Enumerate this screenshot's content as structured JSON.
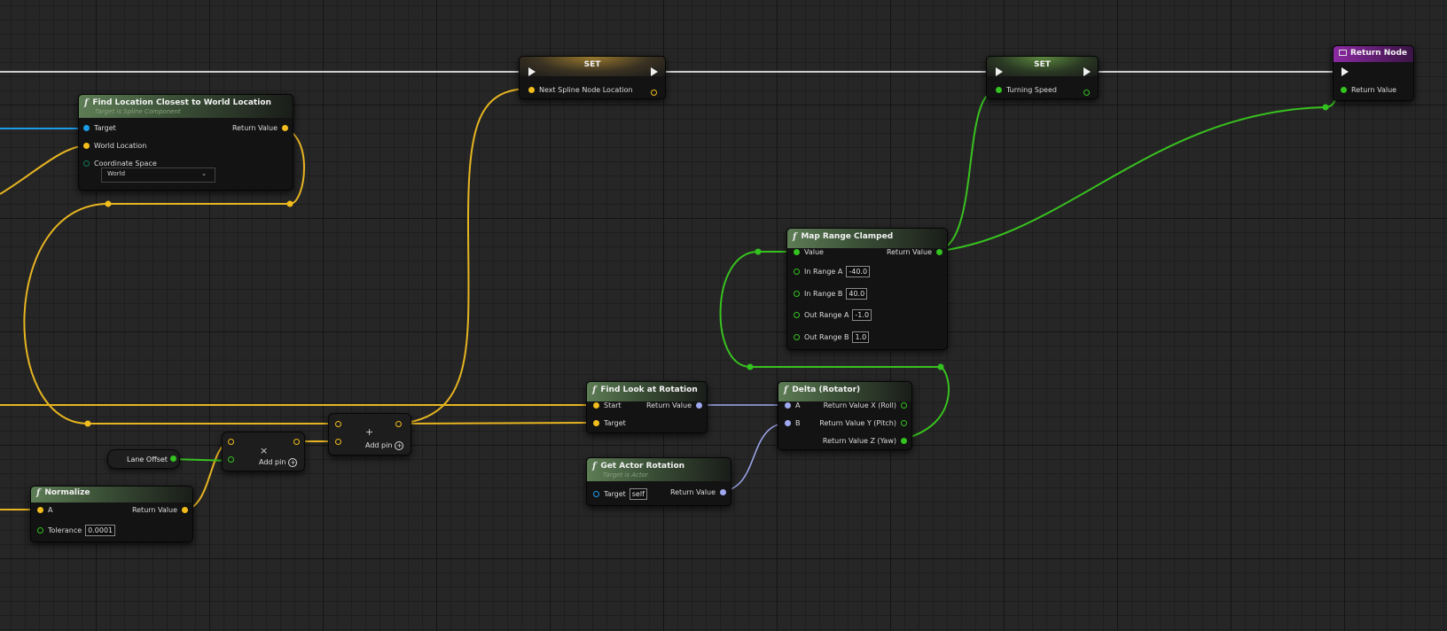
{
  "colors": {
    "exec_wire": "#d9d9d9",
    "vector_pin": "#f2bd1c",
    "float_pin": "#33c21f",
    "object_pin": "#1b9ce6",
    "rotator_pin": "#9fa8ef",
    "return_header": "#8c2aa3"
  },
  "find_location": {
    "title": "Find Location Closest to World Location",
    "subtitle": "Target is Spline Component",
    "target": "Target",
    "world_location": "World Location",
    "return_value": "Return Value",
    "coordinate_space": "Coordinate Space",
    "coordinate_space_value": "World"
  },
  "set_location": {
    "title": "SET",
    "var": "Next Spline Node Location"
  },
  "set_speed": {
    "title": "SET",
    "var": "Turning Speed"
  },
  "return_node": {
    "title": "Return Node",
    "return_value": "Return Value"
  },
  "map_range": {
    "title": "Map Range Clamped",
    "value": "Value",
    "return_value": "Return Value",
    "in_range_a": "In Range A",
    "in_range_a_val": "-40.0",
    "in_range_b": "In Range B",
    "in_range_b_val": "40.0",
    "out_range_a": "Out Range A",
    "out_range_a_val": "-1.0",
    "out_range_b": "Out Range B",
    "out_range_b_val": "1.0"
  },
  "find_look": {
    "title": "Find Look at Rotation",
    "start": "Start",
    "target": "Target",
    "return_value": "Return Value"
  },
  "delta": {
    "title": "Delta (Rotator)",
    "a": "A",
    "b": "B",
    "roll": "Return Value X (Roll)",
    "pitch": "Return Value Y (Pitch)",
    "yaw": "Return Value Z (Yaw)"
  },
  "get_actor_rotation": {
    "title": "Get Actor Rotation",
    "subtitle": "Target is Actor",
    "target": "Target",
    "target_val": "self",
    "return_value": "Return Value"
  },
  "normalize": {
    "title": "Normalize",
    "a": "A",
    "return_value": "Return Value",
    "tolerance": "Tolerance",
    "tolerance_val": "0.0001"
  },
  "lane_offset": {
    "label": "Lane Offset"
  },
  "multiply": {
    "op": "×",
    "add_pin": "Add pin"
  },
  "add": {
    "op": "+",
    "add_pin": "Add pin"
  }
}
